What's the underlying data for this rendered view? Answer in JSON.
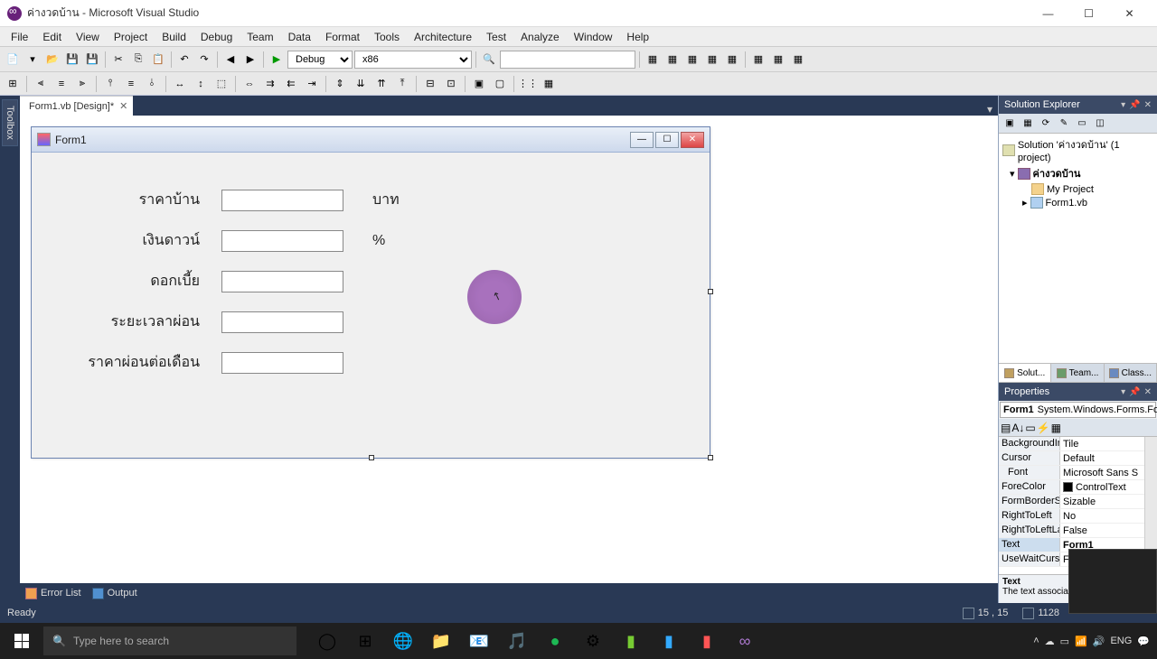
{
  "titlebar": {
    "title": "ค่างวดบ้าน - Microsoft Visual Studio"
  },
  "menu": [
    "File",
    "Edit",
    "View",
    "Project",
    "Build",
    "Debug",
    "Team",
    "Data",
    "Format",
    "Tools",
    "Architecture",
    "Test",
    "Analyze",
    "Window",
    "Help"
  ],
  "toolbar": {
    "config": "Debug",
    "platform": "x86"
  },
  "docTab": {
    "name": "Form1.vb [Design]*"
  },
  "form": {
    "title": "Form1",
    "rows": {
      "r1": {
        "label": "ราคาบ้าน",
        "suffix": "บาท"
      },
      "r2": {
        "label": "เงินดาวน์",
        "suffix": "%"
      },
      "r3": {
        "label": "ดอกเบี้ย",
        "suffix": ""
      },
      "r4": {
        "label": "ระยะเวลาผ่อน",
        "suffix": ""
      },
      "r5": {
        "label": "ราคาผ่อนต่อเดือน",
        "suffix": ""
      }
    }
  },
  "bottomTabs": {
    "errors": "Error List",
    "output": "Output"
  },
  "solExplorer": {
    "title": "Solution Explorer",
    "solution": "Solution 'ค่างวดบ้าน' (1 project)",
    "project": "ค่างวดบ้าน",
    "myproj": "My Project",
    "form": "Form1.vb"
  },
  "rightTabs": {
    "sol": "Solut...",
    "team": "Team...",
    "class": "Class..."
  },
  "properties": {
    "title": "Properties",
    "obj": {
      "name": "Form1",
      "type": "System.Windows.Forms.Form"
    },
    "rows": {
      "BackgroundIm": "Tile",
      "Cursor": "Default",
      "Font": "Microsoft Sans S",
      "ForeColor": "ControlText",
      "FormBorderSty": "Sizable",
      "RightToLeft": "No",
      "RightToLeftLay": "False",
      "Text": "Form1",
      "UseWaitCursor": "False"
    },
    "desc": {
      "name": "Text",
      "text": "The text associated with the control."
    }
  },
  "status": {
    "ready": "Ready",
    "pos": "15 , 15",
    "size": "1128"
  },
  "taskbar": {
    "searchPlaceholder": "Type here to search",
    "tray": {
      "lang": "ENG",
      "time": ""
    }
  },
  "toolboxLabel": "Toolbox"
}
